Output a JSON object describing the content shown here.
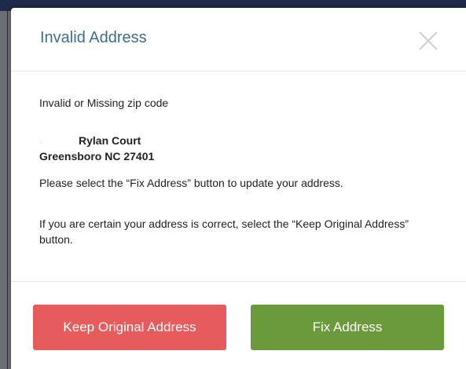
{
  "dialog": {
    "title": "Invalid Address",
    "close_icon": "close-icon"
  },
  "body": {
    "message_invalid": "Invalid or Missing zip code",
    "address_number": "·",
    "address_street": "Rylan Court",
    "address_city_state_zip": "Greensboro NC 27401",
    "message_select": "Please select the “Fix Address” button to update your address.",
    "message_certain": "If you are certain your address is correct, select the “Keep Original Address” button."
  },
  "footer": {
    "keep_label": "Keep Original Address",
    "fix_label": "Fix Address"
  },
  "colors": {
    "title": "#3b6e8f",
    "keep_button": "#e65c5c",
    "fix_button": "#6a9a3c"
  }
}
